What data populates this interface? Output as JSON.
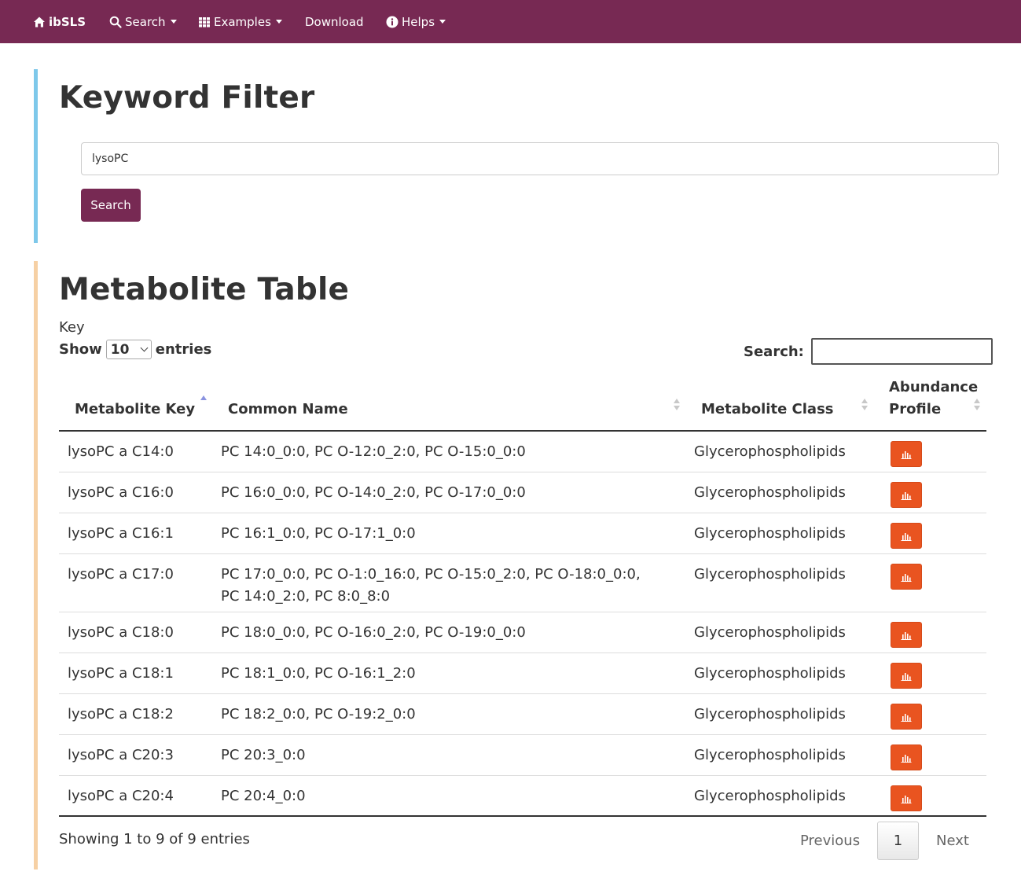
{
  "nav": {
    "brand": "ibSLS",
    "search": "Search",
    "examples": "Examples",
    "download": "Download",
    "helps": "Helps"
  },
  "keyword_filter": {
    "title": "Keyword Filter",
    "input_value": "lysoPC",
    "button_label": "Search"
  },
  "metabolite_table": {
    "title": "Metabolite Table",
    "key_label": "Key",
    "show_label": "Show",
    "show_value": "10",
    "entries_label": "entries",
    "search_label": "Search:",
    "headers": {
      "key": "Metabolite Key",
      "name": "Common Name",
      "class": "Metabolite Class",
      "profile_line1": "Abundance",
      "profile_line2": "Profile"
    },
    "rows": [
      {
        "key": "lysoPC a C14:0",
        "name": "PC 14:0_0:0, PC O-12:0_2:0, PC O-15:0_0:0",
        "class": "Glycerophospholipids"
      },
      {
        "key": "lysoPC a C16:0",
        "name": "PC 16:0_0:0, PC O-14:0_2:0, PC O-17:0_0:0",
        "class": "Glycerophospholipids"
      },
      {
        "key": "lysoPC a C16:1",
        "name": "PC 16:1_0:0, PC O-17:1_0:0",
        "class": "Glycerophospholipids"
      },
      {
        "key": "lysoPC a C17:0",
        "name": "PC 17:0_0:0, PC O-1:0_16:0, PC O-15:0_2:0, PC O-18:0_0:0, PC 14:0_2:0, PC 8:0_8:0",
        "class": "Glycerophospholipids"
      },
      {
        "key": "lysoPC a C18:0",
        "name": "PC 18:0_0:0, PC O-16:0_2:0, PC O-19:0_0:0",
        "class": "Glycerophospholipids"
      },
      {
        "key": "lysoPC a C18:1",
        "name": "PC 18:1_0:0, PC O-16:1_2:0",
        "class": "Glycerophospholipids"
      },
      {
        "key": "lysoPC a C18:2",
        "name": "PC 18:2_0:0, PC O-19:2_0:0",
        "class": "Glycerophospholipids"
      },
      {
        "key": "lysoPC a C20:3",
        "name": "PC 20:3_0:0",
        "class": "Glycerophospholipids"
      },
      {
        "key": "lysoPC a C20:4",
        "name": "PC 20:4_0:0",
        "class": "Glycerophospholipids"
      }
    ],
    "info": "Showing 1 to 9 of 9 entries",
    "pagination": {
      "previous": "Previous",
      "current": "1",
      "next": "Next"
    }
  },
  "colors": {
    "navbar": "#772953",
    "primary_button": "#772953",
    "profile_button": "#e95420",
    "keyword_panel_accent": "#7ec8ea",
    "table_panel_accent": "#f6d0a4"
  },
  "icons": {
    "brand": "home-icon",
    "search": "search-icon",
    "examples": "grid-icon",
    "helps": "info-circle-icon",
    "profile": "bar-chart-icon"
  }
}
